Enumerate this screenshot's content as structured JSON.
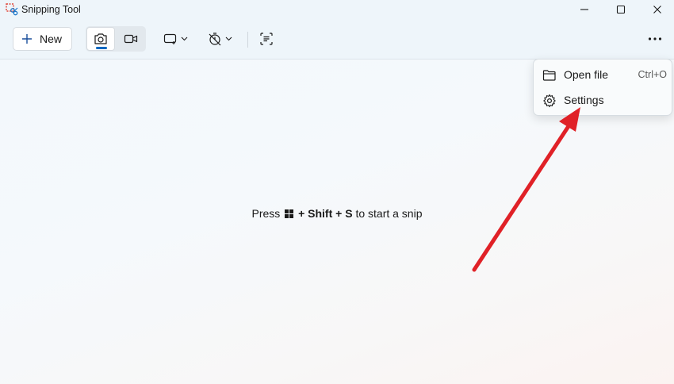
{
  "window": {
    "title": "Snipping Tool"
  },
  "toolbar": {
    "new_label": "New",
    "modes": [
      {
        "name": "camera-icon",
        "selected": true
      },
      {
        "name": "video-camera-icon",
        "selected": false
      }
    ],
    "snip_shape_icon": "rectangle-snip-icon",
    "delay_icon": "timer-off-icon",
    "text_actions_icon": "text-actions-icon",
    "more_icon": "more-options-icon"
  },
  "hint": {
    "press": "Press",
    "plus1": "+",
    "shift": "Shift",
    "plus2": "+",
    "s_key": "S",
    "rest": "to start a snip"
  },
  "menu": {
    "items": [
      {
        "label": "Open file",
        "shortcut": "Ctrl+O",
        "icon": "folder-icon"
      },
      {
        "label": "Settings",
        "shortcut": "",
        "icon": "gear-icon"
      }
    ]
  },
  "colors": {
    "accent": "#0067c0",
    "annotation_arrow": "#e02127",
    "toolbar_bg": "#eef5fa"
  }
}
